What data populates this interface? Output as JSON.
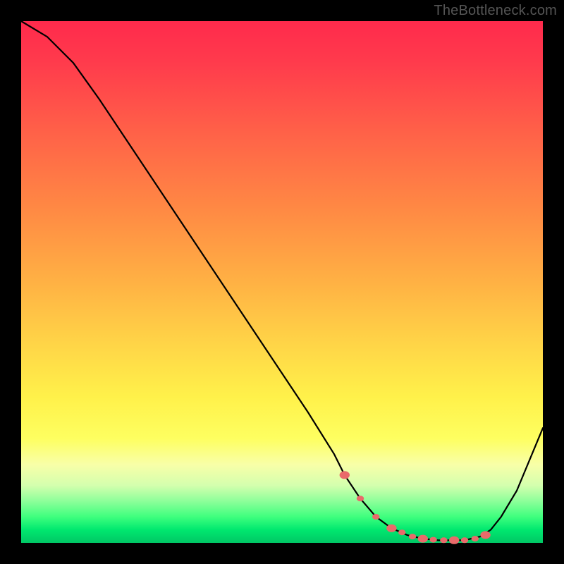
{
  "watermark": "TheBottleneck.com",
  "chart_data": {
    "type": "line",
    "title": "",
    "xlabel": "",
    "ylabel": "",
    "xlim": [
      0,
      100
    ],
    "ylim": [
      0,
      100
    ],
    "x": [
      0,
      5,
      10,
      15,
      20,
      25,
      30,
      35,
      40,
      45,
      50,
      55,
      60,
      62,
      65,
      68,
      71,
      74,
      77,
      80,
      83,
      85,
      88,
      90,
      92,
      95,
      100
    ],
    "y": [
      100,
      97,
      92,
      85,
      77.5,
      70,
      62.5,
      55,
      47.5,
      40,
      32.5,
      25,
      17,
      13,
      8.5,
      5,
      2.8,
      1.5,
      0.8,
      0.5,
      0.5,
      0.5,
      1.2,
      2.5,
      5,
      10,
      22
    ],
    "markers": {
      "x": [
        62,
        65,
        68,
        71,
        73,
        75,
        77,
        79,
        81,
        83,
        85,
        87,
        89
      ],
      "y": [
        13,
        8.5,
        5,
        2.8,
        2.0,
        1.2,
        0.8,
        0.6,
        0.5,
        0.5,
        0.5,
        0.8,
        1.5
      ],
      "color": "#e96a6a"
    },
    "gradient_stops": [
      {
        "pos": 0.0,
        "color": "#ff2a4c"
      },
      {
        "pos": 0.22,
        "color": "#ff6348"
      },
      {
        "pos": 0.5,
        "color": "#ffb144"
      },
      {
        "pos": 0.72,
        "color": "#fff14a"
      },
      {
        "pos": 0.85,
        "color": "#f8ffa8"
      },
      {
        "pos": 0.95,
        "color": "#3fff7e"
      },
      {
        "pos": 1.0,
        "color": "#00c765"
      }
    ]
  }
}
